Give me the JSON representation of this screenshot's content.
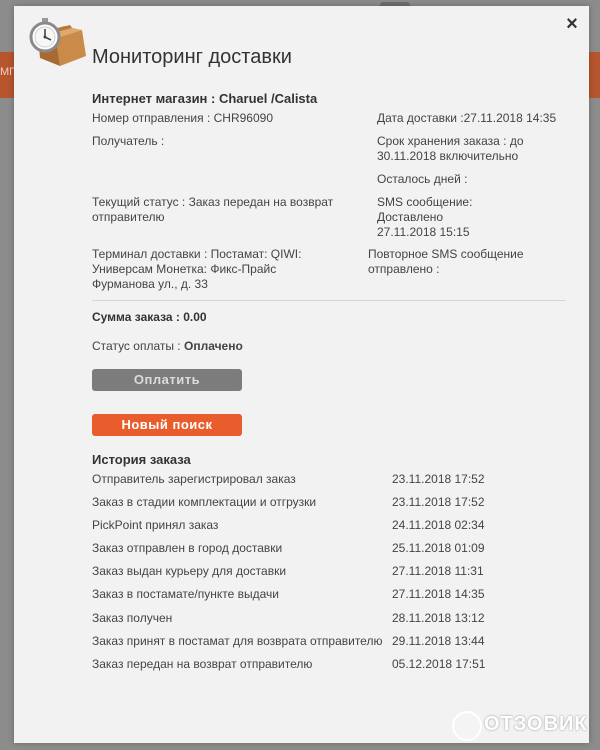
{
  "background": {
    "bar_fragment": "МГ"
  },
  "modal": {
    "close_label": "×",
    "title": "Мониторинг доставки"
  },
  "order": {
    "shop": "Интернет магазин : Charuel /Calista",
    "tracking": "Номер отправления : CHR96090",
    "recipient": "Получатель :",
    "status": "Текущий статус : Заказ передан на возврат отправителю",
    "terminal": "Терминал доставки : Постамат: QIWI: Универсам Монетка: Фикс-Прайс Фурманова ул., д. 33",
    "delivery_date": "Дата доставки :27.11.2018 14:35",
    "storage": "Срок хранения заказа : до 30.11.2018 включительно",
    "days_left": "Осталось дней :",
    "sms": "SMS сообщение: Доставлено 27.11.2018 15:15",
    "repeat_sms": "Повторное SMS сообщение отправлено :",
    "sum": "Сумма заказа : 0.00",
    "payment_label": "Статус оплаты :",
    "payment_value": "Оплачено"
  },
  "buttons": {
    "pay": "Оплатить",
    "new_search": "Новый поиск"
  },
  "history": {
    "title": "История заказа",
    "rows": [
      {
        "event": "Отправитель зарегистрировал заказ",
        "date": "23.11.2018 17:52"
      },
      {
        "event": "Заказ в стадии комплектации и отгрузки",
        "date": "23.11.2018 17:52"
      },
      {
        "event": "PickPoint принял заказ",
        "date": "24.11.2018 02:34"
      },
      {
        "event": "Заказ отправлен в город доставки",
        "date": "25.11.2018 01:09"
      },
      {
        "event": "Заказ выдан курьеру для доставки",
        "date": "27.11.2018 11:31"
      },
      {
        "event": "Заказ в постамате/пункте выдачи",
        "date": "27.11.2018 14:35"
      },
      {
        "event": "Заказ получен",
        "date": "28.11.2018 13:12"
      },
      {
        "event": "Заказ принят в постамат для возврата отправителю",
        "date": "29.11.2018 13:44"
      },
      {
        "event": "Заказ передан на возврат отправителю",
        "date": "05.12.2018 17:51"
      }
    ]
  },
  "watermark": "ОТЗОВИК",
  "icons": {
    "logo": "stopwatch-package-icon",
    "close": "close-icon",
    "watermark": "otzovik-logo-icon"
  },
  "colors": {
    "accent": "#e95d2c",
    "pay_button": "#7c7c7c",
    "modal_bg": "#f2f2f2",
    "bg_bar": "#b7552e"
  }
}
